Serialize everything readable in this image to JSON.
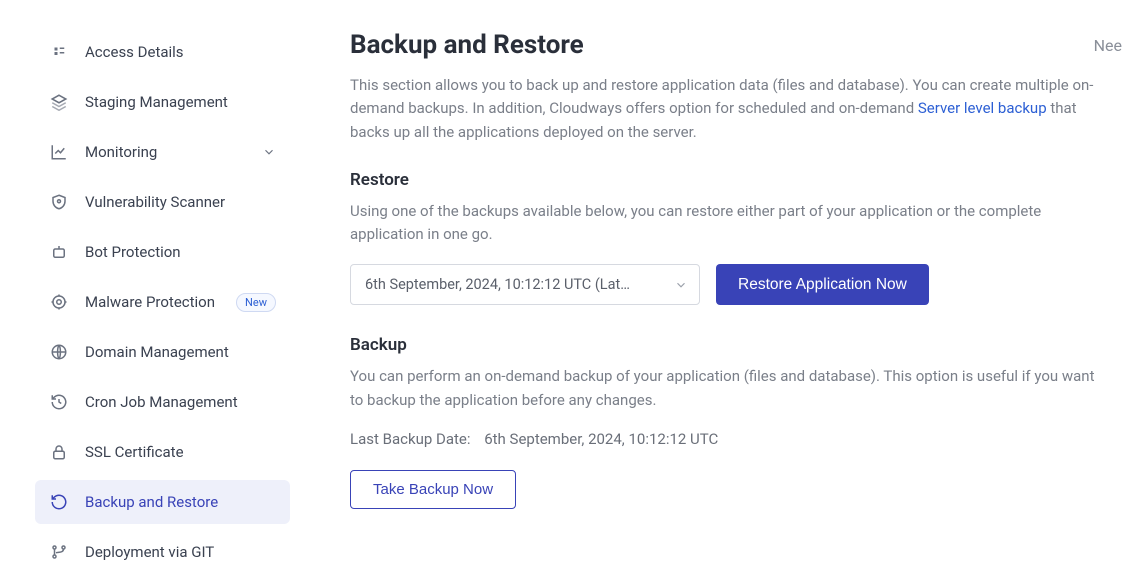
{
  "topRight": "Nee",
  "sidebar": {
    "items": [
      {
        "label": "Access Details"
      },
      {
        "label": "Staging Management"
      },
      {
        "label": "Monitoring",
        "hasChevron": true
      },
      {
        "label": "Vulnerability Scanner"
      },
      {
        "label": "Bot Protection"
      },
      {
        "label": "Malware Protection",
        "badge": "New"
      },
      {
        "label": "Domain Management"
      },
      {
        "label": "Cron Job Management"
      },
      {
        "label": "SSL Certificate"
      },
      {
        "label": "Backup and Restore",
        "active": true
      },
      {
        "label": "Deployment via GIT"
      }
    ]
  },
  "page": {
    "title": "Backup and Restore",
    "description_part1": "This section allows you to back up and restore application data (files and database). You can create multiple on-demand backups. In addition, Cloudways offers option for scheduled and on-demand ",
    "description_link": "Server level backup",
    "description_part2": " that backs up all the applications deployed on the server."
  },
  "restore": {
    "heading": "Restore",
    "description": "Using one of the backups available below, you can restore either part of your application or the complete application in one go.",
    "selected": "6th September, 2024, 10:12:12 UTC (Lat…",
    "button": "Restore Application Now"
  },
  "backup": {
    "heading": "Backup",
    "description": "You can perform an on-demand backup of your application (files and database). This option is useful if you want to backup the application before any changes.",
    "lastLabel": "Last Backup Date:",
    "lastValue": "6th September, 2024, 10:12:12 UTC",
    "button": "Take Backup Now"
  }
}
